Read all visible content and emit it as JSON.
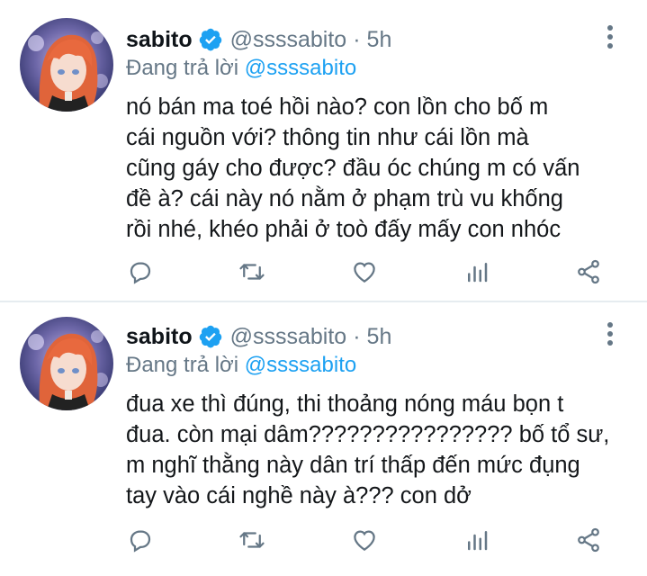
{
  "tweets": [
    {
      "name": "sabito",
      "handle": "@ssssabito",
      "separator": "·",
      "time": "5h",
      "reply_prefix": "Đang trả lời",
      "reply_to": "@ssssabito",
      "lines": [
        "nó bán ma toé hồi nào? con lồn cho bố m",
        "cái nguồn với? thông tin như cái lồn mà",
        "cũng gáy cho được? đầu óc chúng m có vấn",
        "đề à? cái này nó nằm ở phạm trù vu khống",
        "rồi nhé, khéo phải ở toò đấy mấy con nhóc"
      ]
    },
    {
      "name": "sabito",
      "handle": "@ssssabito",
      "separator": "·",
      "time": "5h",
      "reply_prefix": "Đang trả lời",
      "reply_to": "@ssssabito",
      "lines": [
        "đua xe thì đúng, thi thoảng nóng máu bọn t",
        "đua. còn mại dâm???????????????? bố tổ sư,",
        "m nghĩ thằng này dân trí thấp đến mức đụng",
        "tay vào cái nghề này à??? con dở"
      ]
    }
  ],
  "icons": {
    "verified": "verified-badge-icon",
    "more": "more-vertical-icon",
    "reply": "reply-icon",
    "retweet": "retweet-icon",
    "like": "heart-icon",
    "analytics": "analytics-icon",
    "share": "share-icon"
  },
  "colors": {
    "accent": "#1da1f2",
    "text": "#0f1419",
    "secondary": "#657786",
    "divider": "#e6ecf0"
  }
}
